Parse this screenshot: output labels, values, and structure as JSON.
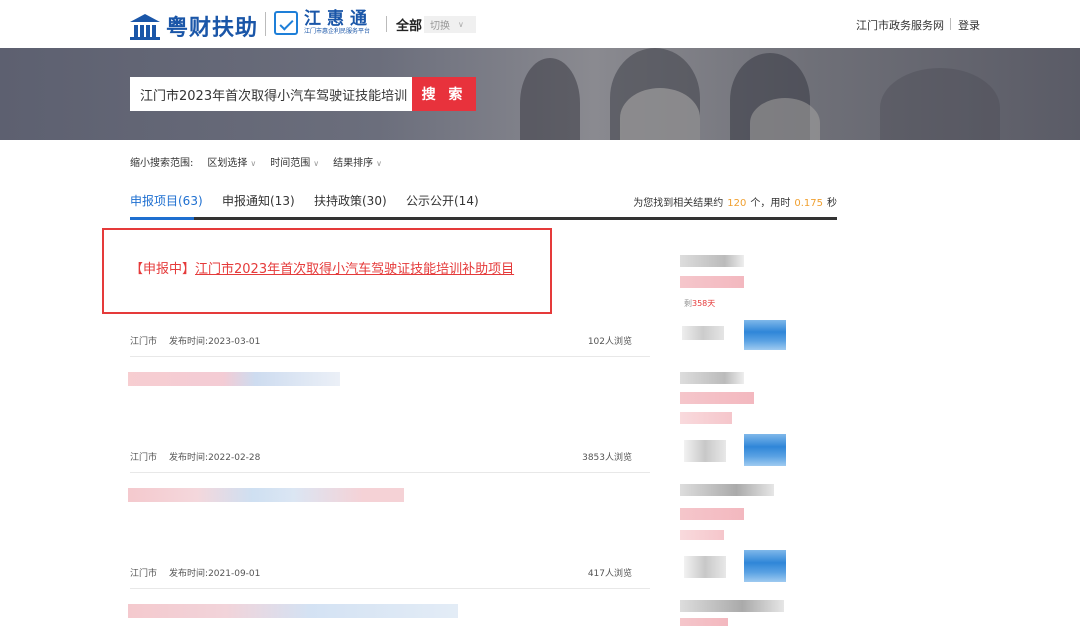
{
  "header": {
    "brand": "粤财扶助",
    "sub_brand": "江惠通",
    "sub_brand_caption": "江门市惠企利民服务平台",
    "region": "全部",
    "switch_label": "切换",
    "gov_link": "江门市政务服务网",
    "login": "登录"
  },
  "search": {
    "value": "江门市2023年首次取得小汽车驾驶证技能培训",
    "button": "搜 索"
  },
  "filters": {
    "label": "缩小搜索范围:",
    "items": [
      "区划选择",
      "时间范围",
      "结果排序"
    ]
  },
  "tabs": [
    {
      "label": "申报项目(63)",
      "active": true
    },
    {
      "label": "申报通知(13)",
      "active": false
    },
    {
      "label": "扶持政策(30)",
      "active": false
    },
    {
      "label": "公示公开(14)",
      "active": false
    }
  ],
  "stats": {
    "prefix": "为您找到相关结果约",
    "count": "120",
    "mid": "个，用时",
    "time": "0.175",
    "suffix": "秒"
  },
  "results": [
    {
      "status": "【申报中】",
      "title": "江门市2023年首次取得小汽车驾驶证技能培训补助项目",
      "region": "江门市",
      "date_label": "发布时间:",
      "date": "2023-03-01",
      "views": "102人浏览"
    },
    {
      "region": "江门市",
      "date_label": "发布时间:",
      "date": "2022-02-28",
      "views": "3853人浏览"
    },
    {
      "region": "江门市",
      "date_label": "发布时间:",
      "date": "2021-09-01",
      "views": "417人浏览"
    }
  ],
  "sidebar": {
    "remain_prefix": "剩",
    "remain_days": "358天"
  },
  "colors": {
    "brand_blue": "#1a56a8",
    "accent_red": "#e8323c",
    "tab_blue": "#1e6fd0",
    "stat_orange": "#f0a030"
  }
}
